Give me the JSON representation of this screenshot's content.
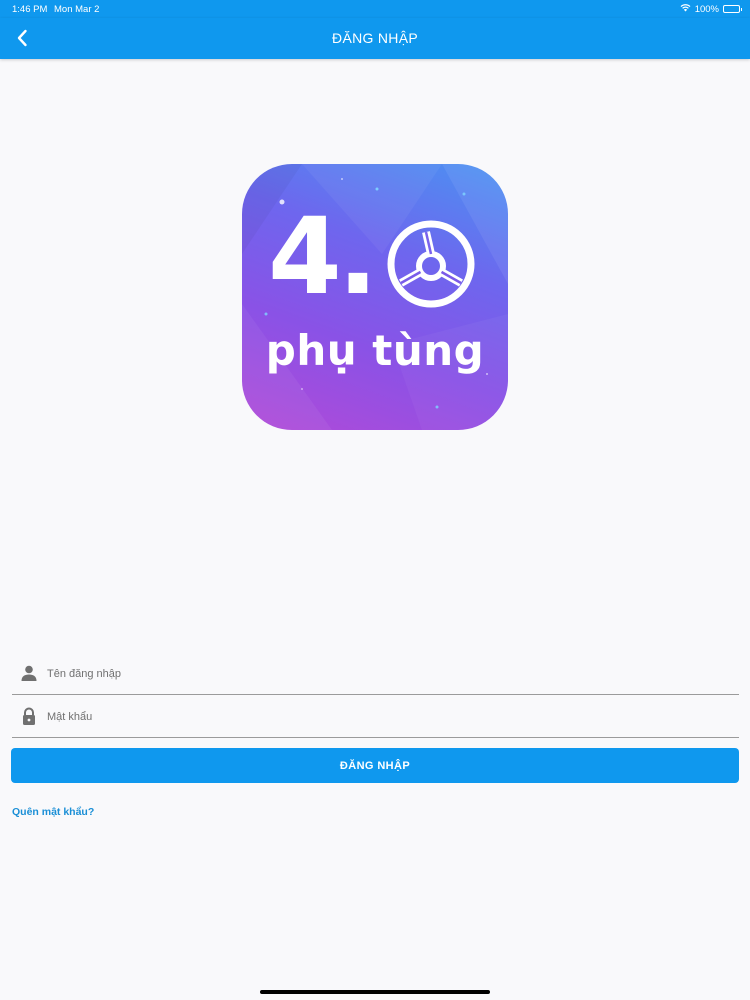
{
  "status_bar": {
    "time": "1:46 PM",
    "date": "Mon Mar 2",
    "battery": "100%",
    "battery_level": 1.0
  },
  "nav": {
    "title": "ĐĂNG NHẬP",
    "back_icon": "chevron-left-icon"
  },
  "logo": {
    "number": "4.",
    "text": "phụ tùng",
    "wheel_icon": "steering-wheel-icon"
  },
  "form": {
    "username_placeholder": "Tên đăng nhập",
    "username_value": "",
    "username_icon": "user-icon",
    "password_placeholder": "Mật khẩu",
    "password_value": "",
    "password_icon": "lock-icon",
    "login_label": "ĐĂNG NHẬP",
    "forgot_label": "Quên mật khẩu?"
  },
  "colors": {
    "primary": "#0f98ee",
    "link": "#1b8fd6",
    "background": "#f9f9fb"
  }
}
